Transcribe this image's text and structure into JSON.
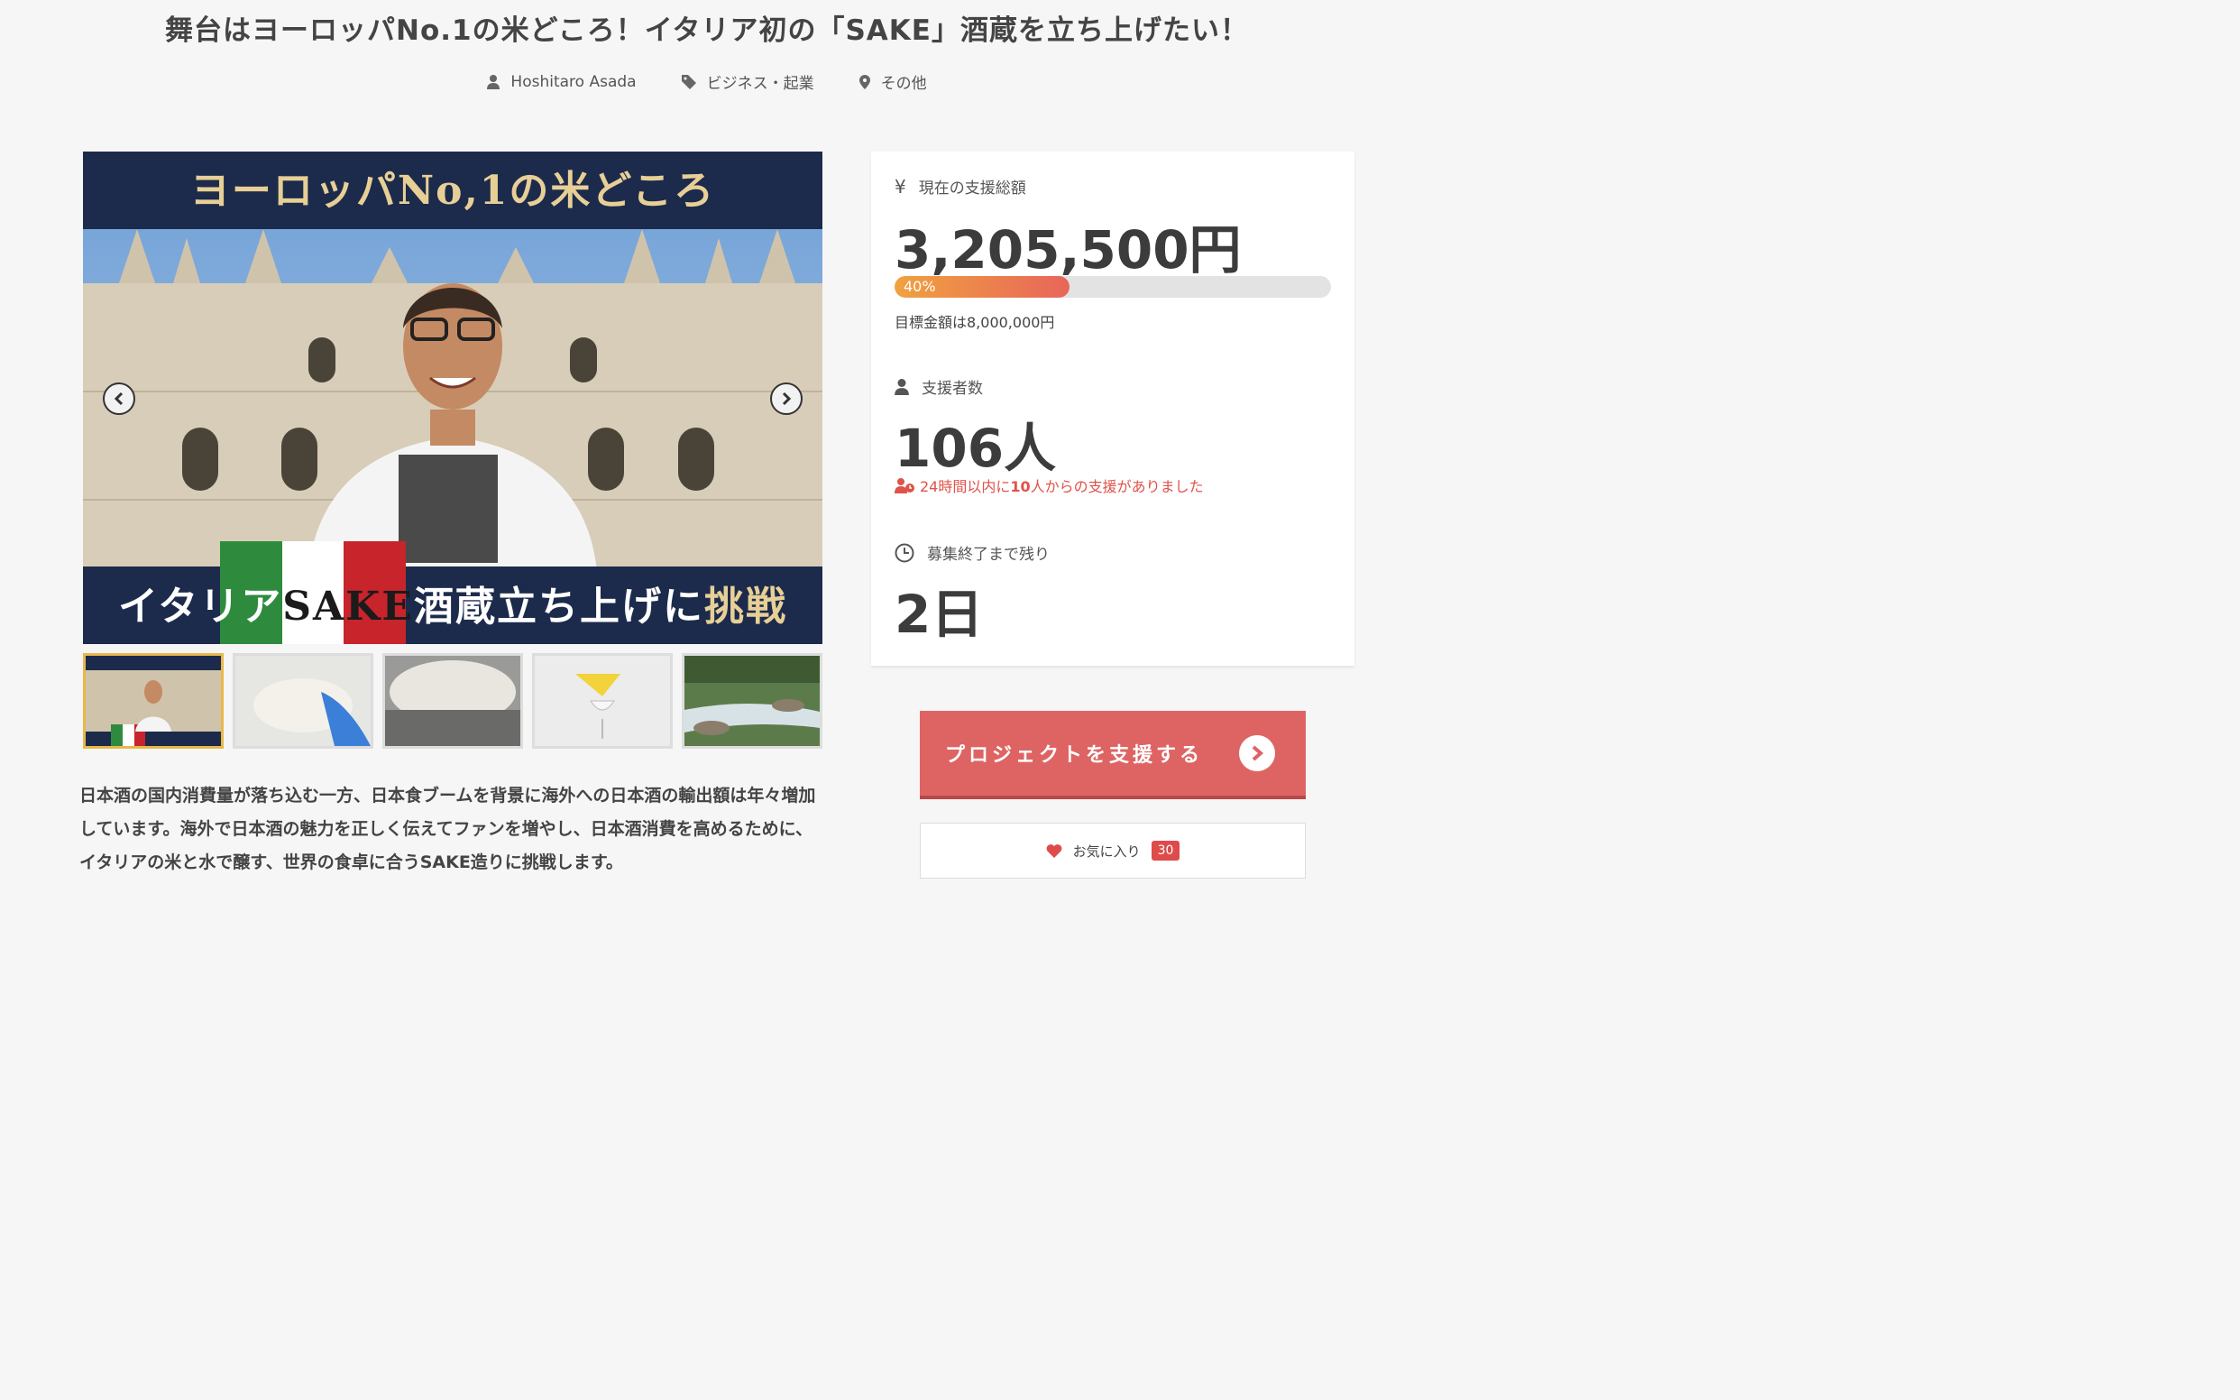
{
  "title": "舞台はヨーロッパNo.1の米どころ！イタリア初の「SAKE」酒蔵を立ち上げたい！",
  "meta": {
    "author": "Hoshitaro Asada",
    "category": "ビジネス・起業",
    "location": "その他"
  },
  "hero": {
    "top_text": "ヨーロッパNo,1の米どころ",
    "bottom_text_pre": "イタリア",
    "bottom_text_sake": "SAKE",
    "bottom_text_mid": "酒蔵立ち上げに",
    "bottom_text_gold": "挑戦"
  },
  "thumbnails": [
    {
      "name": "thumb-cathedral",
      "active": true
    },
    {
      "name": "thumb-rice",
      "active": false
    },
    {
      "name": "thumb-tank",
      "active": false
    },
    {
      "name": "thumb-funnel",
      "active": false
    },
    {
      "name": "thumb-river",
      "active": false
    }
  ],
  "description": "日本酒の国内消費量が落ち込む一方、日本食ブームを背景に海外への日本酒の輸出額は年々増加しています。海外で日本酒の魅力を正しく伝えてファンを増やし、日本酒消費を高めるために、イタリアの米と水で醸す、世界の食卓に合うSAKE造りに挑戦します。",
  "stats": {
    "amount_label": "現在の支援総額",
    "amount": "3,205,500円",
    "progress_label": "40%",
    "progress": 0.4,
    "goal": "目標金額は8,000,000円",
    "backers_label": "支援者数",
    "backers": "106人",
    "recent_pre": "24時間以内に",
    "recent_count": "10",
    "recent_post": "人からの支援がありました",
    "remaining_label": "募集終了まで残り",
    "remaining": "2日"
  },
  "actions": {
    "support_label": "プロジェクトを支援する",
    "favorite_label": "お気に入り",
    "favorite_count": "30"
  },
  "colors": {
    "accent": "#de6464",
    "navy": "#1c2b4c",
    "gold": "#e7cf96"
  }
}
